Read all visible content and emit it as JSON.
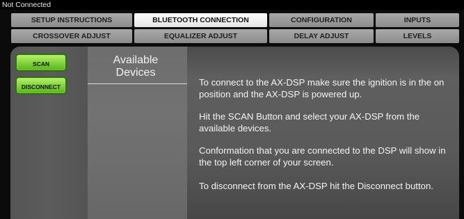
{
  "status": {
    "connection": "Not Connected"
  },
  "tabs_row1": [
    {
      "label": "SETUP INSTRUCTIONS",
      "active": false
    },
    {
      "label": "BLUETOOTH CONNECTION",
      "active": true
    },
    {
      "label": "CONFIGURATION",
      "active": false
    },
    {
      "label": "INPUTS",
      "active": false
    }
  ],
  "tabs_row2": [
    {
      "label": "CROSSOVER ADJUST"
    },
    {
      "label": "EQUALIZER ADJUST"
    },
    {
      "label": "DELAY ADJUST"
    },
    {
      "label": "LEVELS"
    }
  ],
  "buttons": {
    "scan": "SCAN",
    "disconnect": "DISCONNECT"
  },
  "devices": {
    "title_line1": "Available",
    "title_line2": "Devices"
  },
  "instructions": [
    "To connect to the AX-DSP make sure the ignition is in the on position and the AX-DSP is powered up.",
    "Hit the SCAN Button and select your AX-DSP from the available devices.",
    "Conformation that you are connected to the DSP will show in the top left corner of your screen.",
    "To disconnect from the AX-DSP hit the Disconnect button."
  ],
  "colors": {
    "accent_green": "#79cf35",
    "active_tab": "#ffffff",
    "inactive_tab": "#9c9c9c",
    "panel": "#5a5a5a"
  }
}
